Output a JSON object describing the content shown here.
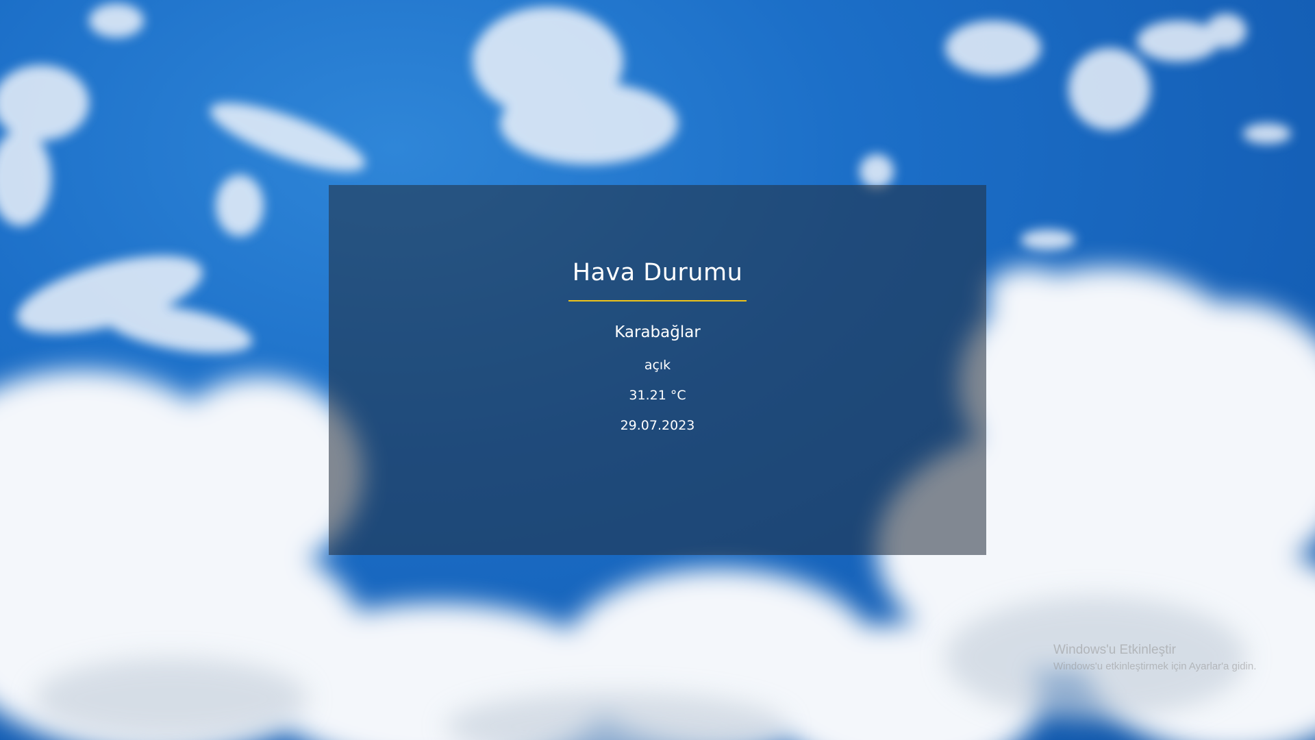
{
  "card": {
    "title": "Hava Durumu",
    "city": "Karabağlar",
    "description": "açık",
    "temperature": "31.21 °C",
    "date": "29.07.2023"
  },
  "watermark": {
    "title": "Windows'u Etkinleştir",
    "subtitle": "Windows'u etkinleştirmek için Ayarlar'a gidin."
  },
  "colors": {
    "sky": "#1c6fc8",
    "card_overlay": "rgba(35,45,60,0.55)",
    "accent_underline": "#f0c419",
    "text": "#ffffff"
  },
  "background": {
    "description": "blue sky with white clouds"
  }
}
